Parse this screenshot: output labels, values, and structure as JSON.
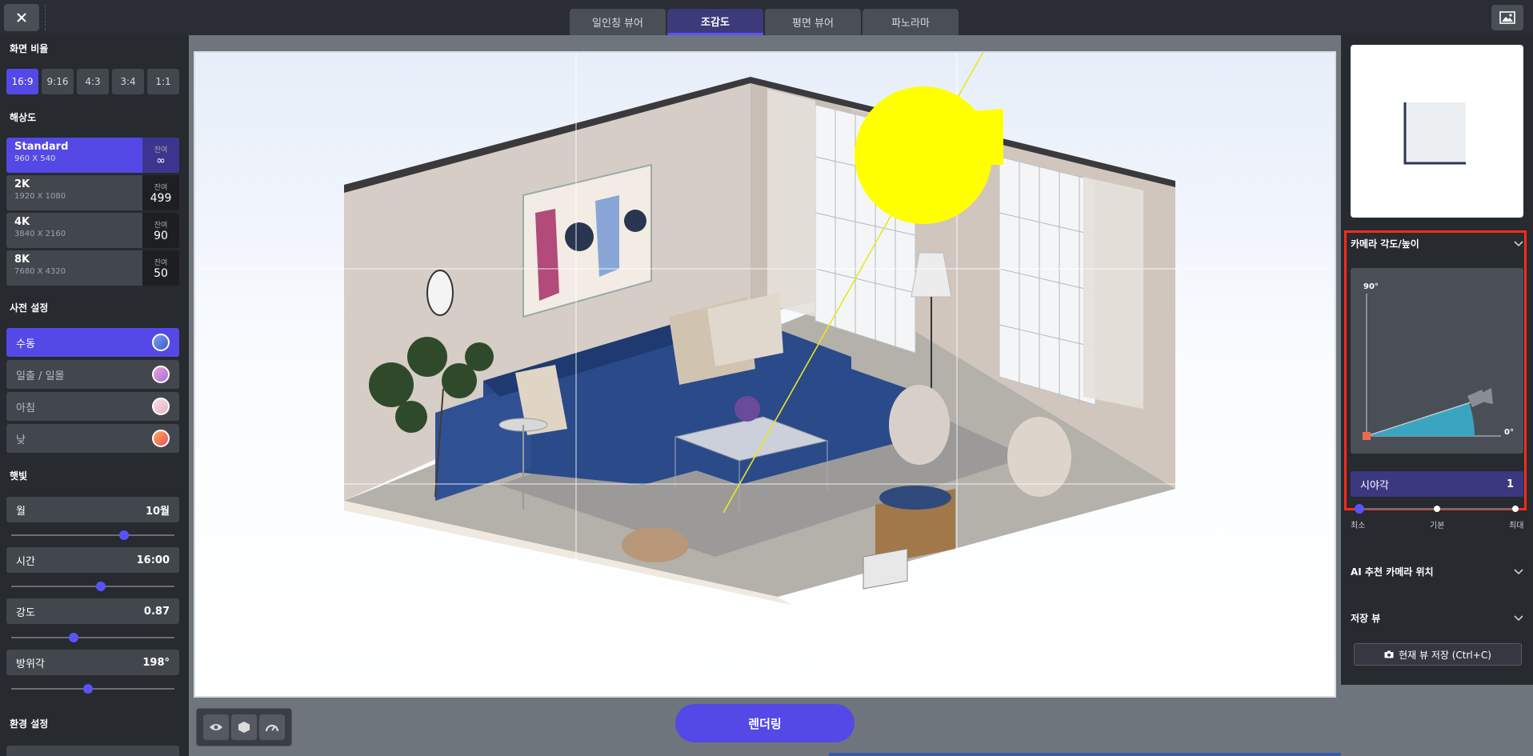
{
  "topbar": {
    "tabs": [
      "일인칭 뷰어",
      "조감도",
      "평면 뷰어",
      "파노라마"
    ],
    "active_tab": 1
  },
  "left": {
    "ratio_title": "화면 비율",
    "ratios": [
      "16:9",
      "9:16",
      "4:3",
      "3:4",
      "1:1"
    ],
    "resolution_title": "해상도",
    "resolutions": [
      {
        "name": "Standard",
        "dim": "960 X 540",
        "label": "잔여",
        "count": "∞"
      },
      {
        "name": "2K",
        "dim": "1920 X 1080",
        "label": "잔여",
        "count": "499"
      },
      {
        "name": "4K",
        "dim": "3840 X 2160",
        "label": "잔여",
        "count": "90"
      },
      {
        "name": "8K",
        "dim": "7680 X 4320",
        "label": "잔여",
        "count": "50"
      }
    ],
    "preset_title": "사전 설정",
    "presets": [
      {
        "label": "수동",
        "color": "#4a7bd8"
      },
      {
        "label": "일출 / 일몰",
        "color": "#d98ad8"
      },
      {
        "label": "아침",
        "color": "#f0c8d4"
      },
      {
        "label": "낮",
        "color": "#f06a58"
      }
    ],
    "sunlight_title": "햇빛",
    "sliders": [
      {
        "label": "월",
        "value": "10월",
        "pct": 0.69
      },
      {
        "label": "시간",
        "value": "16:00",
        "pct": 0.55
      },
      {
        "label": "강도",
        "value": "0.87",
        "pct": 0.38
      },
      {
        "label": "방위각",
        "value": "198°",
        "pct": 0.47
      }
    ],
    "env_title": "환경 설정"
  },
  "viewport": {
    "render_label": "렌더링"
  },
  "right": {
    "camera_title": "카메라 각도/높이",
    "angle_top": "90°",
    "angle_bottom": "0°",
    "fov_label": "시야각",
    "fov_value": "1",
    "fov_min": "최소",
    "fov_mid": "기본",
    "fov_max": "최대",
    "ai_title": "AI 추천 카메라 위치",
    "saved_title": "저장 뷰",
    "save_btn": "현재 뷰 저장 (Ctrl+C)"
  },
  "colors": {
    "accent": "#5448e6",
    "highlight": "#ff2a1a",
    "sun": "#ffff00"
  }
}
